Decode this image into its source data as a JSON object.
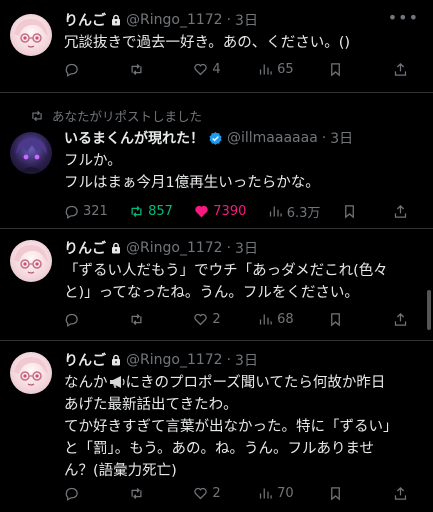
{
  "posts": [
    {
      "name": "りんご",
      "handle": "@Ringo_1172",
      "sep": "·",
      "time": "3日",
      "lines": [
        "冗談抜きで過去一好き。あの、ください。()"
      ],
      "replies": "",
      "reposts": "",
      "likes": "4",
      "views": "65"
    },
    {
      "repost_label": "あなたがリポストしました",
      "name": "いるまくんが現れた！",
      "handle": "@illmaaaaaa",
      "sep": "·",
      "time": "3日",
      "lines": [
        "フルか。",
        "フルはまぁ今月1億再生いったらかな。"
      ],
      "replies": "321",
      "reposts": "857",
      "likes": "7390",
      "views": "6.3万"
    },
    {
      "name": "りんご",
      "handle": "@Ringo_1172",
      "sep": "·",
      "time": "3日",
      "lines": [
        "「ずるい人だもう」でウチ「あっダメだこれ(色々",
        "と)」ってなったね。うん。フルをください。"
      ],
      "replies": "",
      "reposts": "",
      "likes": "2",
      "views": "68"
    },
    {
      "name": "りんご",
      "handle": "@Ringo_1172",
      "sep": "·",
      "time": "3日",
      "line1_pre": "なんか",
      "line1_post": "にきのプロポーズ聞いてたら何故か昨日",
      "lines": [
        "あげた最新話出てきたわ。",
        "てか好きすぎて言葉が出なかった。特に「ずるい」",
        "と「罰」。もう。あの。ね。うん。フルありませ",
        "ん？(語彙力死亡)"
      ],
      "replies": "",
      "reposts": "",
      "likes": "2",
      "views": "70"
    }
  ],
  "icons": {
    "reply": "reply-icon",
    "repost": "repost-icon",
    "like": "heart-icon",
    "views": "views-icon",
    "bookmark": "bookmark-icon",
    "share": "share-icon",
    "more": "more-icon",
    "lock": "lock-icon",
    "verified": "verified-badge-icon",
    "megaphone": "megaphone-emoji"
  },
  "colors": {
    "background": "#000000",
    "text": "#e7e9ea",
    "muted": "#71767b",
    "repost_active": "#00ba7c",
    "like_active": "#f91880",
    "verified": "#1d9bf0"
  }
}
